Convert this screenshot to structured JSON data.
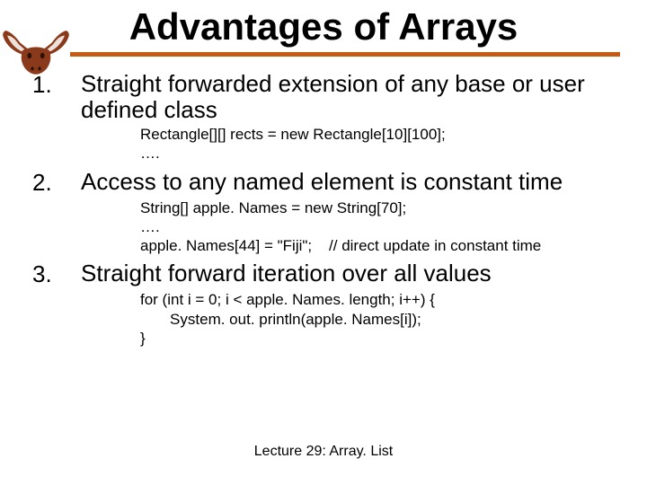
{
  "title": "Advantages of Arrays",
  "items": [
    {
      "num": "1.",
      "text": "Straight forwarded extension of any base or user defined class",
      "code": "Rectangle[][] rects = new Rectangle[10][100];\n…."
    },
    {
      "num": "2.",
      "text": "Access to any named element is constant time",
      "code": "String[] apple. Names = new String[70];\n….\napple. Names[44] = \"Fiji\";    // direct update in constant time"
    },
    {
      "num": "3.",
      "text": "Straight forward iteration over all values",
      "code": "for (int i = 0; i < apple. Names. length; i++) {\n       System. out. println(apple. Names[i]);\n}"
    }
  ],
  "footer": "Lecture 29: Array. List"
}
